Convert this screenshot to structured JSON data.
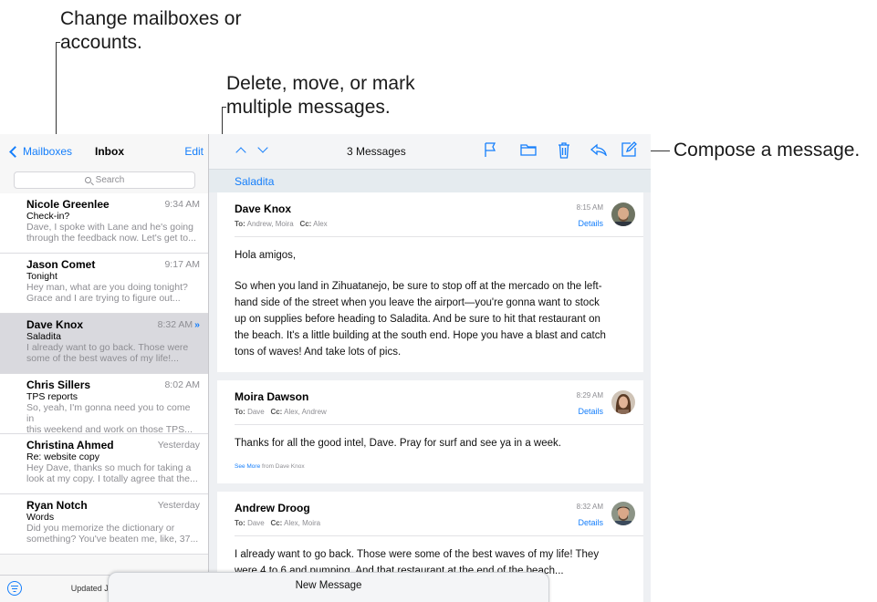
{
  "callouts": {
    "mailboxes_line1": "Change mailboxes or",
    "mailboxes_line2": "accounts.",
    "edit_line1": "Delete, move, or mark",
    "edit_line2": "multiple messages.",
    "compose": "Compose a message."
  },
  "sidebar": {
    "back_label": "Mailboxes",
    "title": "Inbox",
    "edit_label": "Edit",
    "search_placeholder": "Search",
    "status": "Updated Just Now",
    "messages": [
      {
        "from": "Nicole Greenlee",
        "time": "9:34 AM",
        "subject": "Check-in?",
        "preview1": "Dave, I spoke with Lane and he's going",
        "preview2": "through the feedback now. Let's get to..."
      },
      {
        "from": "Jason Comet",
        "time": "9:17 AM",
        "subject": "Tonight",
        "preview1": "Hey man, what are you doing tonight?",
        "preview2": "Grace and I are trying to figure out..."
      },
      {
        "from": "Dave Knox",
        "time": "8:32 AM",
        "subject": "Saladita",
        "preview1": "I already want to go back. Those were",
        "preview2": "some of the best waves of my life!..."
      },
      {
        "from": "Chris Sillers",
        "time": "8:02 AM",
        "subject": "TPS reports",
        "preview1": "So, yeah, I'm gonna need you to come in",
        "preview2": "this weekend and work on those TPS..."
      },
      {
        "from": "Christina Ahmed",
        "time": "Yesterday",
        "subject": "Re: website copy",
        "preview1": "Hey Dave, thanks so much for taking a",
        "preview2": "look at my copy. I totally agree that the..."
      },
      {
        "from": "Ryan Notch",
        "time": "Yesterday",
        "subject": "Words",
        "preview1": "Did you memorize the dictionary or",
        "preview2": "something? You've beaten me, like, 37..."
      }
    ]
  },
  "detail": {
    "title": "3 Messages",
    "thread_subject": "Saladita",
    "cards": [
      {
        "sender": "Dave Knox",
        "to_label": "To:",
        "to": "Andrew, Moira",
        "cc_label": "Cc:",
        "cc": "Alex",
        "time": "8:15 AM",
        "details": "Details",
        "greeting": "Hola amigos,",
        "body1": "So when you land in Zihuatanejo, be sure to stop off at the mercado on the left-",
        "body2": "hand side of the street when you leave the airport—you're gonna want to stock",
        "body3": "up on supplies before heading to Saladita. And be sure to hit that restaurant on",
        "body4": "the beach. It's a little building at the south end. Hope you have a blast and catch",
        "body5": "tons of waves! And take lots of pics."
      },
      {
        "sender": "Moira Dawson",
        "to_label": "To:",
        "to": "Dave",
        "cc_label": "Cc:",
        "cc": "Alex, Andrew",
        "time": "8:29 AM",
        "details": "Details",
        "body1": "Thanks for all the good intel, Dave. Pray for surf and see ya in a week.",
        "see_more": "See More",
        "see_more_from": "from Dave Knox"
      },
      {
        "sender": "Andrew Droog",
        "to_label": "To:",
        "to": "Dave",
        "cc_label": "Cc:",
        "cc": "Alex, Moira",
        "time": "8:32 AM",
        "details": "Details",
        "body1": "I already want to go back. Those were some of the best waves of my life! They",
        "body2": "were 4 to 6 and pumping. And that restaurant at the end of the beach..."
      }
    ],
    "new_message": "New Message"
  },
  "colors": {
    "accent": "#147efb",
    "selected_row": "#d9d9de",
    "secondary_text": "#8e8e93"
  },
  "icons": [
    "chevron-left-icon",
    "search-icon",
    "filter-icon",
    "chevron-up-icon",
    "chevron-down-icon",
    "flag-icon",
    "folder-icon",
    "trash-icon",
    "reply-icon",
    "compose-icon",
    "forward-double-chevron-icon"
  ]
}
